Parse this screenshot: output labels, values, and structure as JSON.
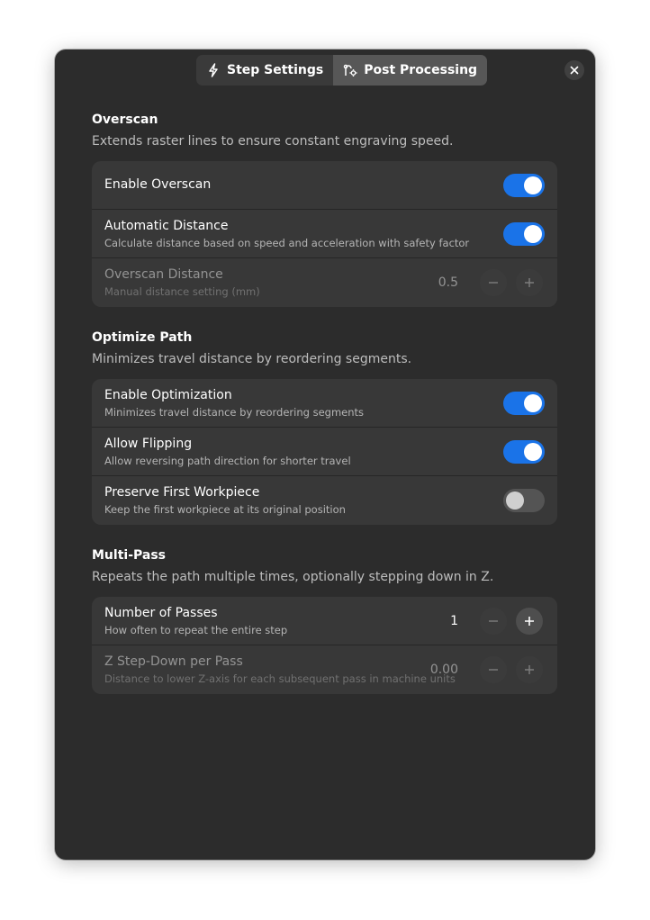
{
  "tabs": [
    {
      "label": "Step Settings",
      "icon": "lightning-icon",
      "active": false
    },
    {
      "label": "Post Processing",
      "icon": "path-settings-icon",
      "active": true
    }
  ],
  "colors": {
    "accent": "#1a73e8",
    "window_bg": "#2c2c2c",
    "card_bg": "#383838"
  },
  "overscan": {
    "title": "Overscan",
    "desc": "Extends raster lines to ensure constant engraving speed.",
    "enable": {
      "label": "Enable Overscan",
      "on": true
    },
    "auto": {
      "label": "Automatic Distance",
      "sub": "Calculate distance based on speed and acceleration with safety factor",
      "on": true
    },
    "distance": {
      "label": "Overscan Distance",
      "sub": "Manual distance setting (mm)",
      "value": "0.5"
    }
  },
  "optimize": {
    "title": "Optimize Path",
    "desc": "Minimizes travel distance by reordering segments.",
    "enable": {
      "label": "Enable Optimization",
      "sub": "Minimizes travel distance by reordering segments",
      "on": true
    },
    "flip": {
      "label": "Allow Flipping",
      "sub": "Allow reversing path direction for shorter travel",
      "on": true
    },
    "preserve": {
      "label": "Preserve First Workpiece",
      "sub": "Keep the first workpiece at its original position",
      "on": false
    }
  },
  "multipass": {
    "title": "Multi-Pass",
    "desc": "Repeats the path multiple times, optionally stepping down in Z.",
    "passes": {
      "label": "Number of Passes",
      "sub": "How often to repeat the entire step",
      "value": "1"
    },
    "zstep": {
      "label": "Z Step-Down per Pass",
      "sub": "Distance to lower Z-axis for each subsequent pass in machine units",
      "value": "0.00"
    }
  }
}
